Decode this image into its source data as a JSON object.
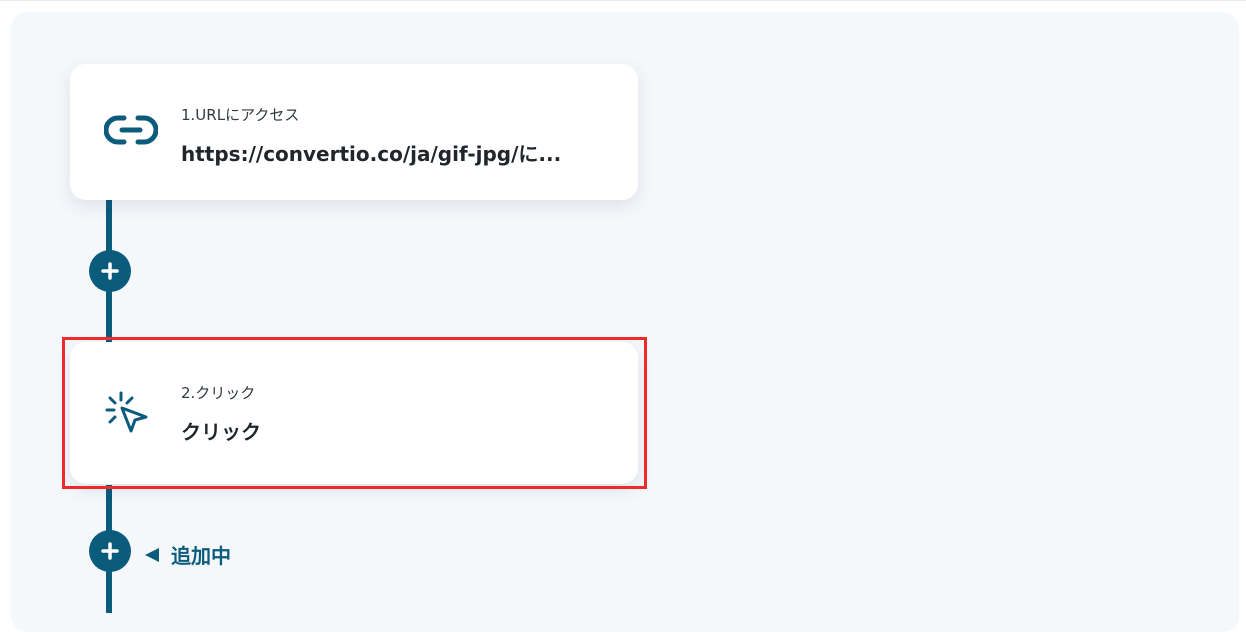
{
  "steps": [
    {
      "label": "1.URLにアクセス",
      "title": "https://convertio.co/ja/gif-jpg/に...",
      "icon": "link-icon"
    },
    {
      "label": "2.クリック",
      "title": "クリック",
      "icon": "cursor-click-icon"
    }
  ],
  "adding_label": "追加中",
  "colors": {
    "accent": "#0b5b7c",
    "highlight": "#ee2b2b",
    "canvas": "#f5f8fb"
  }
}
